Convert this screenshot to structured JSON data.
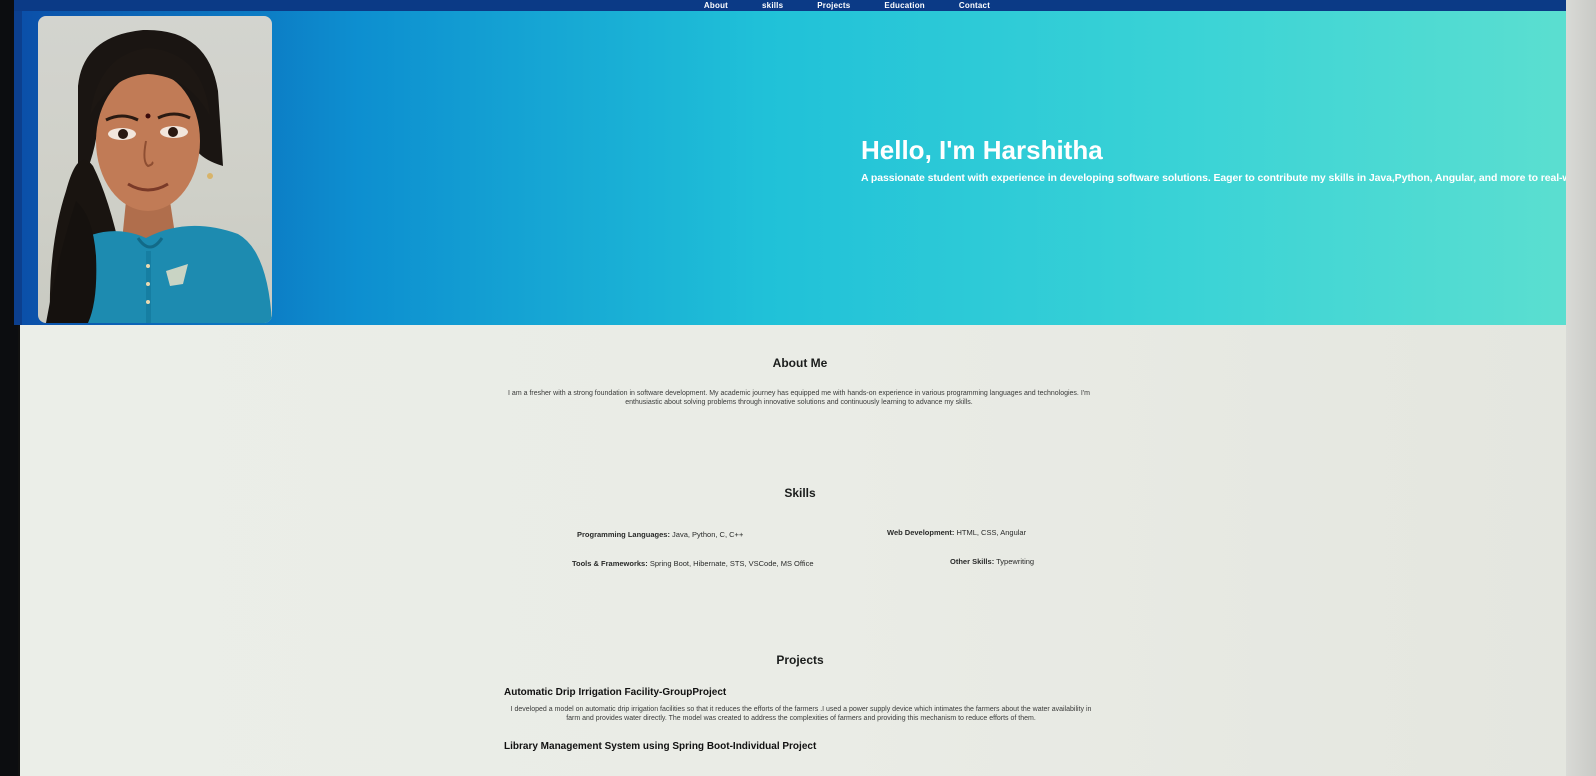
{
  "nav": {
    "items": [
      "About",
      "skills",
      "Projects",
      "Education",
      "Contact"
    ]
  },
  "hero": {
    "title": "Hello, I'm Harshitha",
    "subtitle": "A passionate student with experience in developing software solutions. Eager to contribute my skills in Java,Python, Angular, and more to real-world projects"
  },
  "about": {
    "heading": "About Me",
    "text": "I am a fresher with a strong foundation in software development. My academic journey has equipped me with hands-on experience in various programming languages and technologies. I'm enthusiastic about solving problems through innovative solutions and continuously learning to advance my skills."
  },
  "skills": {
    "heading": "Skills",
    "items": [
      {
        "label": "Programming Languages",
        "value": "Java, Python, C, C++"
      },
      {
        "label": "Web Development",
        "value": "HTML, CSS, Angular"
      },
      {
        "label": "Tools & Frameworks",
        "value": "Spring Boot, Hibernate, STS, VSCode, MS Office"
      },
      {
        "label": "Other Skills",
        "value": "Typewriting"
      }
    ]
  },
  "projects": {
    "heading": "Projects",
    "items": [
      {
        "title": "Automatic Drip Irrigation Facility-GroupProject",
        "description": "I developed a model on automatic drip irrigation facilities so that it reduces the efforts of the farmers .I used a power supply device which intimates the farmers about the water availability in farm and provides water directly. The model was created to address the complexities of farmers and providing this mechanism to reduce efforts of them."
      },
      {
        "title": "Library Management System using Spring Boot-Individual Project",
        "description": ""
      }
    ]
  },
  "colors": {
    "nav_bg": "#0b3a86",
    "hero_gradient_start": "#0b4ea8",
    "hero_gradient_end": "#5cdfd0",
    "content_bg": "#ebeee8"
  }
}
